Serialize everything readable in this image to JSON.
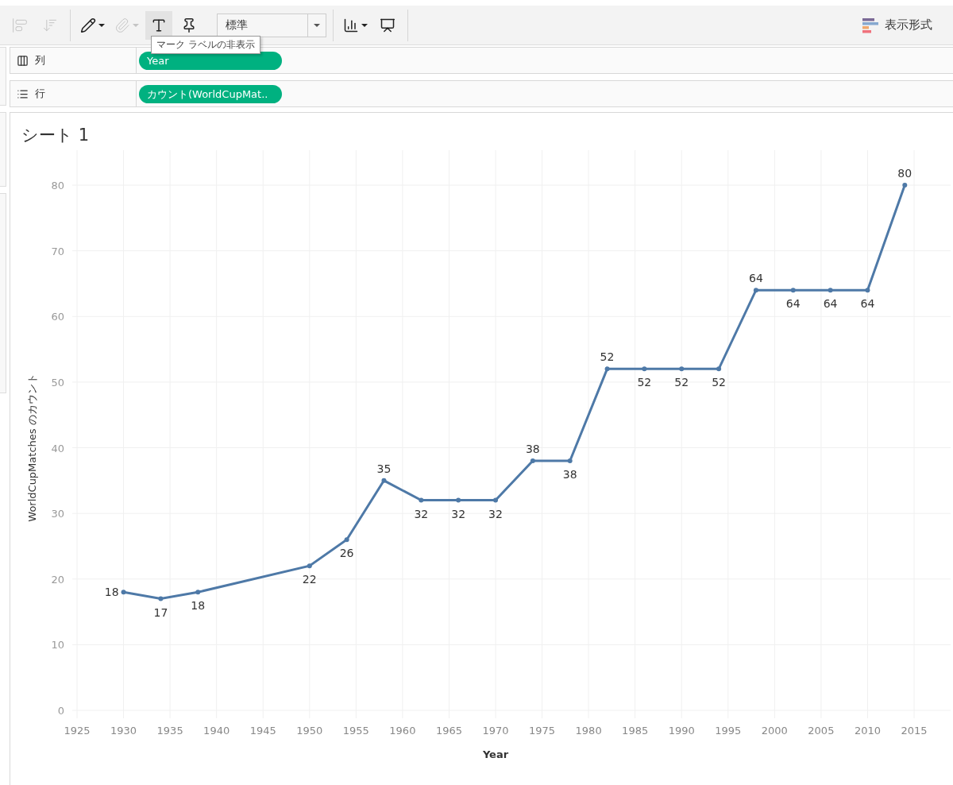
{
  "toolbar": {
    "tools": [
      {
        "kind": "align",
        "selected": false,
        "disabled": true
      },
      {
        "kind": "sort",
        "selected": false,
        "disabled": true
      },
      {
        "kind": "highlight",
        "selected": false,
        "disabled": false
      },
      {
        "kind": "attach",
        "selected": false,
        "disabled": true
      },
      {
        "kind": "labels",
        "selected": true,
        "disabled": false
      },
      {
        "kind": "pin",
        "selected": false,
        "disabled": false
      }
    ],
    "size_select": {
      "value": "標準"
    },
    "tools_right": [
      {
        "kind": "showme",
        "selected": false,
        "disabled": false
      },
      {
        "kind": "present",
        "selected": false,
        "disabled": false
      }
    ],
    "tooltip": "マーク ラベルの非表示",
    "format_button": "表示形式"
  },
  "shelves": [
    {
      "kind": "columns",
      "label": "列",
      "pill": "Year"
    },
    {
      "kind": "rows",
      "label": "行",
      "pill": "カウント(WorldCupMat.."
    }
  ],
  "sheet": {
    "title": "シート 1",
    "chart_data": {
      "type": "line",
      "xlabel": "Year",
      "ylabel": "WorldCupMatches のカウント",
      "x": [
        1930,
        1934,
        1938,
        1950,
        1954,
        1958,
        1962,
        1966,
        1970,
        1974,
        1978,
        1982,
        1986,
        1990,
        1994,
        1998,
        2002,
        2006,
        2010,
        2014
      ],
      "series": [
        {
          "color": "#4e79a7",
          "marker": true,
          "values": [
            18,
            17,
            18,
            22,
            26,
            35,
            32,
            32,
            32,
            38,
            38,
            52,
            52,
            52,
            52,
            64,
            64,
            64,
            64,
            80
          ]
        }
      ],
      "xlim": [
        1925,
        2015
      ],
      "ylim": [
        0,
        80
      ],
      "grid": true,
      "xticks": [
        1925,
        1930,
        1935,
        1940,
        1945,
        1950,
        1955,
        1960,
        1965,
        1970,
        1975,
        1980,
        1985,
        1990,
        1995,
        2000,
        2005,
        2010,
        2015
      ],
      "yticks": [
        0,
        10,
        20,
        30,
        40,
        50,
        60,
        70,
        80
      ],
      "data_labels": true
    }
  }
}
